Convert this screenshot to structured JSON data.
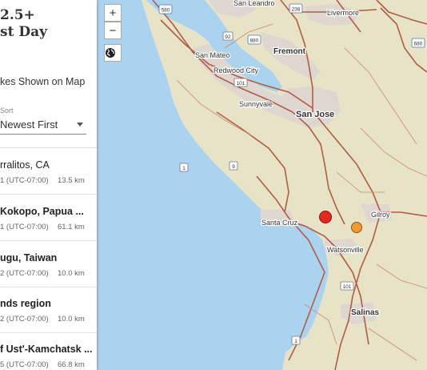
{
  "panel": {
    "title_line1": "2.5+",
    "title_line2": "st Day",
    "shown_label": "kes Shown on Map",
    "sort_label": "Sort",
    "sort_value": "Newest First",
    "earthquakes": [
      {
        "place": "rralitos, CA",
        "time": "1 (UTC-07:00)",
        "depth": "13.5 km",
        "bold": false
      },
      {
        "place": "Kokopo, Papua ...",
        "time": "1 (UTC-07:00)",
        "depth": "61.1 km",
        "bold": true
      },
      {
        "place": "ugu, Taiwan",
        "time": "2 (UTC-07:00)",
        "depth": "10.0 km",
        "bold": true
      },
      {
        "place": "nds region",
        "time": "2 (UTC-07:00)",
        "depth": "10.0 km",
        "bold": true
      },
      {
        "place": "f Ust'-Kamchatsk ...",
        "time": "5 (UTC-07:00)",
        "depth": "66.8 km",
        "bold": true
      }
    ]
  },
  "map": {
    "zoom_in": "+",
    "zoom_out": "−",
    "basemap_icon": "globe-icon",
    "labels": {
      "san_leandro": "San Leandro",
      "livermore": "Livermore",
      "fremont": "Fremont",
      "san_mateo": "San Mateo",
      "redwood_city": "Redwood City",
      "sunnyvale": "Sunnyvale",
      "san_jose": "San Jose",
      "santa_cruz": "Santa Cruz",
      "gilroy": "Gilroy",
      "watsonville": "Watsonville",
      "salinas": "Salinas"
    },
    "shields": {
      "s580": "580",
      "s238": "238",
      "s680": "680",
      "s92": "92",
      "s880": "880",
      "s101a": "101",
      "s1a": "1",
      "s9": "9",
      "s101b": "101",
      "s1b": "1"
    },
    "colors": {
      "water": "#a9d3ee",
      "land": "#e6e3c7",
      "urban": "#ddd7d0",
      "road": "#b35b47",
      "marker_red": "#e8261c",
      "marker_orange": "#f29a2e"
    }
  }
}
